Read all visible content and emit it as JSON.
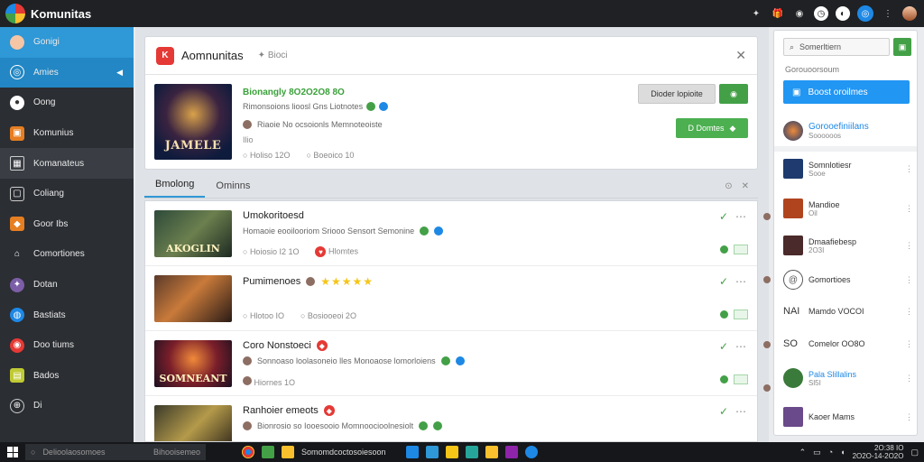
{
  "app": {
    "title": "Komunitas"
  },
  "topbar": {
    "icons": [
      "pin-icon",
      "gift-icon",
      "bell-icon",
      "clock-icon",
      "chat-icon",
      "more-icon",
      "avatar"
    ]
  },
  "sidebar": {
    "items": [
      {
        "label": "Gonigi",
        "icon": "avatar",
        "color": "#f5c6a5"
      },
      {
        "label": "Amies",
        "icon": "compass-icon",
        "color": "#2f98d6"
      },
      {
        "label": "Oong",
        "icon": "circle-icon",
        "color": "#555"
      },
      {
        "label": "Komunius",
        "icon": "cube-icon",
        "color": "#e67e22"
      },
      {
        "label": "Komanateus",
        "icon": "grid-icon",
        "color": "#666"
      },
      {
        "label": "Coliang",
        "icon": "chat-icon",
        "color": "#555"
      },
      {
        "label": "Goor Ibs",
        "icon": "gamepad-icon",
        "color": "#e67e22"
      },
      {
        "label": "Comortiones",
        "icon": "home-icon",
        "color": "#555"
      },
      {
        "label": "Dotan",
        "icon": "sword-icon",
        "color": "#7b5ea7"
      },
      {
        "label": "Bastiats",
        "icon": "globe-icon",
        "color": "#1e88e5"
      },
      {
        "label": "Doo tiums",
        "icon": "record-icon",
        "color": "#e53935"
      },
      {
        "label": "Bados",
        "icon": "badge-icon",
        "color": "#c0ca33"
      },
      {
        "label": "Di",
        "icon": "settings-icon",
        "color": "#555"
      }
    ]
  },
  "header": {
    "badge": "K",
    "title": "Aomnunitas",
    "subtitle": "Bioci"
  },
  "feature": {
    "cover_text": "JAMELE",
    "title": "Bionangly 8O2O2O8 8O",
    "meta": "Rimonsoions lioosl Gns Liotnotes",
    "user": "Riaoie No ocsoionls  Memnoteoiste",
    "small": "Ilio",
    "stats": [
      "Holiso 12O",
      "Boeoico 10"
    ],
    "btn_secondary": "Dioder lopioite",
    "btn_primary": "D Domtes"
  },
  "tabs": [
    {
      "label": "Bmolong"
    },
    {
      "label": "Ominns"
    }
  ],
  "list": [
    {
      "title": "Umokoritoesd",
      "meta": "Homaoie eooilooriom Sriooo Sensort Semonine",
      "stats": [
        "Hoiosio I2 1O",
        "Hlomtes"
      ],
      "thumb_text": "AKOGLIN",
      "thumb_bg": "linear-gradient(135deg,#2e4a3a,#6b7f4e 50%,#1d2a22)"
    },
    {
      "title": "Pumimenoes",
      "meta": "",
      "stars": "★★★★★",
      "stats": [
        "Hlotoo IO",
        "Bosiooeoi 2O"
      ],
      "thumb_text": "",
      "thumb_bg": "linear-gradient(135deg,#5a3a2a,#c97a3a 45%,#2a1b16)"
    },
    {
      "title": "Coro Nonstoeci",
      "meta": "Sonnoaso loolasoneio lles  Monoaose lomorloiens",
      "stats": [
        "Hiornes 1O"
      ],
      "thumb_text": "SOMNEANT",
      "thumb_bg": "radial-gradient(circle at 50% 40%,#f08a3a,#7a1e2a 50%,#1a1020)"
    },
    {
      "title": "Ranhoier emeots",
      "meta": "Bionrosio so Iooesooio Momnoocioolnesiolt",
      "stats": [],
      "thumb_text": "",
      "thumb_bg": "linear-gradient(135deg,#3a3a2a,#b49a4a 50%,#2a2218)"
    }
  ],
  "right": {
    "search_placeholder": "Somerltiern",
    "heading": "Gorouoorsoum",
    "cta": "Boost oroilmes",
    "featured": {
      "title": "Gorooefiniilans",
      "sub": "Soooooos"
    },
    "items": [
      {
        "title": "Somnlotiesr",
        "sub": "Sooe",
        "color": "#1e3a6e"
      },
      {
        "title": "Mandioe",
        "sub": "Oil",
        "color": "#b0441e"
      },
      {
        "title": "Dmaafiebesp",
        "sub": "2O3I",
        "color": "#4a2a2a"
      },
      {
        "title": "Gomortioes",
        "sub": "",
        "color": "#ffffff"
      },
      {
        "title": "Mamdo VOCOI",
        "sub": "",
        "color": "#ffffff",
        "lead": "NAI"
      },
      {
        "title": "Comelor OO8O",
        "sub": "",
        "color": "#ffffff",
        "lead": "SO"
      },
      {
        "title": "Pala Slillalins",
        "sub": "Sl5I",
        "color": "#3a7a3a",
        "accent": true
      },
      {
        "title": "Kaoer Mams",
        "sub": "",
        "color": "#6a4a8a"
      }
    ]
  },
  "taskbar": {
    "search_placeholder": "Delioolaosomoes",
    "search_extra": "Bihooisemeo",
    "app_label": "Somomdcoctosoiesoon",
    "time": "2O:38 IO",
    "date": "2O2O-14-2O2O"
  }
}
